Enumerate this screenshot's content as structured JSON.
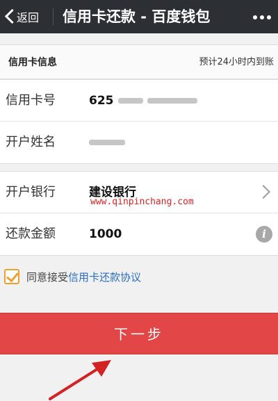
{
  "header": {
    "back_label": "返回",
    "title": "信用卡还款 - 百度钱包"
  },
  "section": {
    "label": "信用卡信息",
    "note": "预计24小时内到账"
  },
  "card_group": {
    "card_number_label": "信用卡号",
    "card_number_value": "625",
    "holder_label": "开户姓名"
  },
  "pay_group": {
    "bank_label": "开户银行",
    "bank_value": "建设银行",
    "amount_label": "还款金额",
    "amount_value": "1000"
  },
  "watermark": "www.qinpinchang.com",
  "agreement": {
    "prefix": "同意接受",
    "link": "信用卡还款协议",
    "checked": true
  },
  "next_button": "下一步",
  "colors": {
    "titlebar": "#2c3035",
    "next_button": "#e34646",
    "link": "#2a6fc4",
    "checkbox": "#f0a030",
    "annotation_arrow": "#d22222"
  },
  "icons": [
    "back-chevron-icon",
    "more-icon",
    "chevron-right-icon",
    "info-icon",
    "checkbox-checked-icon",
    "annotation-arrow"
  ]
}
